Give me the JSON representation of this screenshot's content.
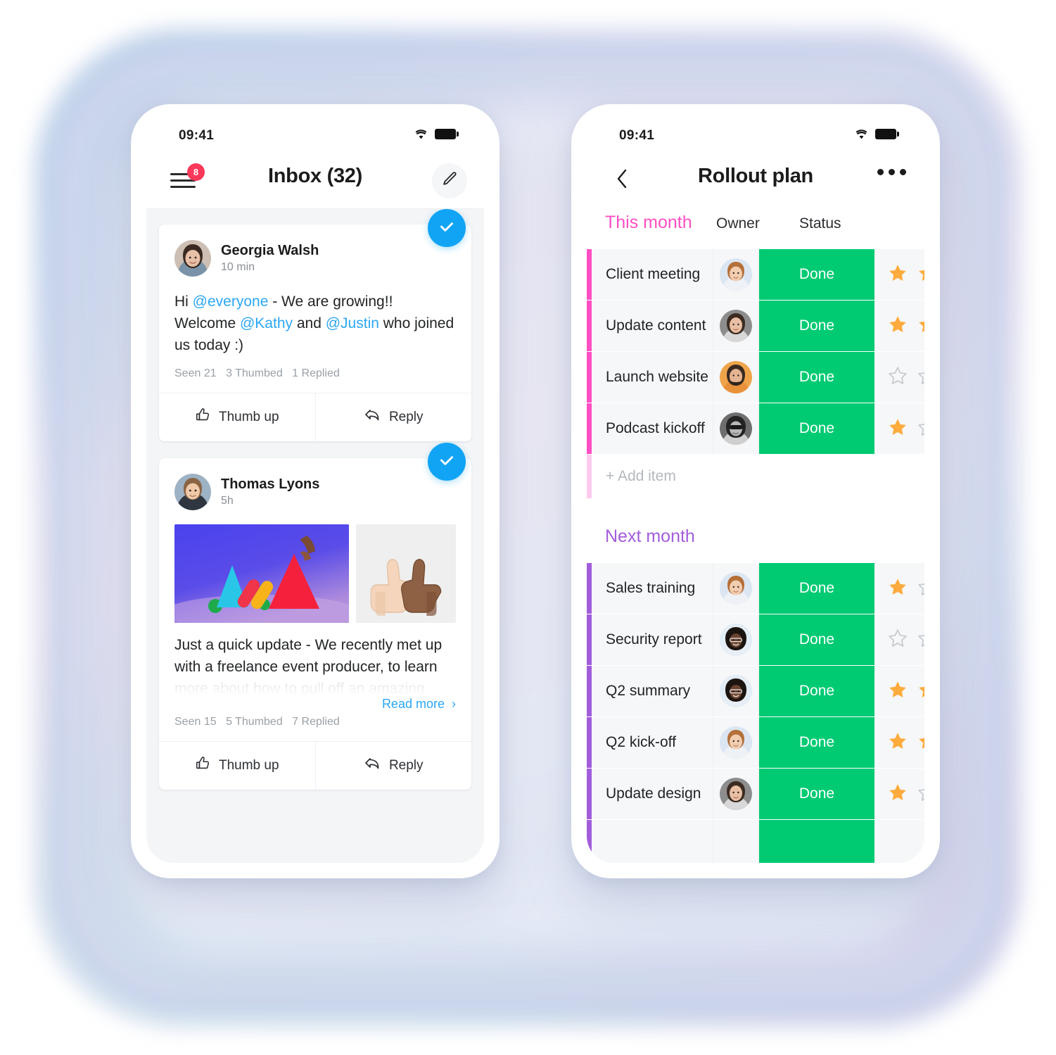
{
  "colors": {
    "accent_blue": "#12a4f4",
    "status_green": "#00ca72",
    "group_pink": "#ff4fc3",
    "group_purple": "#a25ddc",
    "badge_red": "#f9385a",
    "star_gold": "#fdab3d",
    "mention_blue": "#2ca7f2"
  },
  "phone_left": {
    "status_bar": {
      "time": "09:41",
      "wifi": "wifi-icon",
      "battery": "battery-icon"
    },
    "appbar": {
      "menu_badge": "8",
      "title": "Inbox (32)",
      "edit_icon": "pencil-icon"
    },
    "posts": [
      {
        "author": "Georgia Walsh",
        "time": "10 min",
        "body_parts": [
          {
            "text": "Hi ",
            "type": "plain"
          },
          {
            "text": "@everyone",
            "type": "mention"
          },
          {
            "text": " - We are growing!! Welcome ",
            "type": "plain"
          },
          {
            "text": "@Kathy",
            "type": "mention"
          },
          {
            "text": " and ",
            "type": "plain"
          },
          {
            "text": "@Justin",
            "type": "mention"
          },
          {
            "text": " who joined us today :)",
            "type": "plain"
          }
        ],
        "meta": {
          "seen": "Seen 21",
          "thumbed": "3  Thumbed",
          "replied": "1 Replied"
        },
        "actions": {
          "thumb": "Thumb up",
          "reply": "Reply"
        },
        "has_media": false,
        "read_more": null
      },
      {
        "author": "Thomas Lyons",
        "time": "5h",
        "body_visible": "Just a quick update - We recently met up with a freelance event producer, to learn",
        "body_faded": "more about how to pull off an amazing",
        "read_more": "Read more",
        "meta": {
          "seen": "Seen 15",
          "thumbed": "5  Thumbed",
          "replied": "7 Replied"
        },
        "actions": {
          "thumb": "Thumb up",
          "reply": "Reply"
        },
        "has_media": true,
        "media": [
          {
            "name": "shapes-illustration-image"
          },
          {
            "name": "thumbs-up-hands-image"
          }
        ]
      }
    ]
  },
  "phone_right": {
    "status_bar": {
      "time": "09:41",
      "wifi": "wifi-icon",
      "battery": "battery-icon"
    },
    "appbar": {
      "back_icon": "chevron-left-icon",
      "title": "Rollout plan",
      "more_icon": "more-horizontal-icon"
    },
    "columns": {
      "owner": "Owner",
      "status": "Status"
    },
    "groups": [
      {
        "title": "This month",
        "accent": "pink",
        "rows": [
          {
            "name": "Client meeting",
            "owner": "avatar-male-1",
            "status": "Done",
            "stars": [
              true,
              true
            ]
          },
          {
            "name": "Update content",
            "owner": "avatar-female-1",
            "status": "Done",
            "stars": [
              true,
              true
            ]
          },
          {
            "name": "Launch website",
            "owner": "avatar-male-2",
            "status": "Done",
            "stars": [
              false,
              false
            ]
          },
          {
            "name": "Podcast kickoff",
            "owner": "avatar-female-2",
            "status": "Done",
            "stars": [
              true,
              false
            ]
          }
        ],
        "add_item": "+ Add item"
      },
      {
        "title": "Next month",
        "accent": "purple",
        "rows": [
          {
            "name": "Sales training",
            "owner": "avatar-male-1",
            "status": "Done",
            "stars": [
              true,
              false
            ]
          },
          {
            "name": "Security report",
            "owner": "avatar-female-3",
            "status": "Done",
            "stars": [
              false,
              false
            ]
          },
          {
            "name": "Q2 summary",
            "owner": "avatar-female-3",
            "status": "Done",
            "stars": [
              true,
              true
            ]
          },
          {
            "name": "Q2 kick-off",
            "owner": "avatar-male-1",
            "status": "Done",
            "stars": [
              true,
              true
            ]
          },
          {
            "name": "Update design",
            "owner": "avatar-female-1",
            "status": "Done",
            "stars": [
              true,
              false
            ]
          }
        ],
        "add_item": null
      }
    ]
  }
}
